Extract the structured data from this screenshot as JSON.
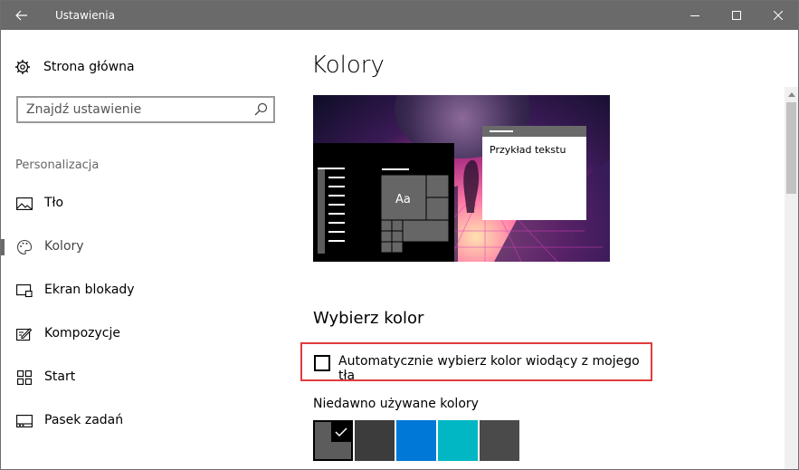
{
  "window": {
    "title": "Ustawienia"
  },
  "sidebar": {
    "home_label": "Strona główna",
    "search_placeholder": "Znajdź ustawienie",
    "section_label": "Personalizacja",
    "items": [
      {
        "label": "Tło",
        "icon": "picture-icon"
      },
      {
        "label": "Kolory",
        "icon": "palette-icon",
        "active": true
      },
      {
        "label": "Ekran blokady",
        "icon": "lock-screen-icon"
      },
      {
        "label": "Kompozycje",
        "icon": "themes-icon"
      },
      {
        "label": "Start",
        "icon": "start-icon"
      },
      {
        "label": "Pasek zadań",
        "icon": "taskbar-icon"
      }
    ]
  },
  "main": {
    "title": "Kolory",
    "preview": {
      "tile_label": "Aa",
      "sample_text": "Przykład tekstu"
    },
    "choose_color_title": "Wybierz kolor",
    "auto_color_label": "Automatycznie wybierz kolor wiodący z mojego tła",
    "auto_color_checked": false,
    "recent_colors_label": "Niedawno używane kolory",
    "recent_colors": [
      "#5c5c5c",
      "#3c3c3c",
      "#0078d7",
      "#00b7c3",
      "#4a4a4a"
    ],
    "selected_color_index": 0
  },
  "colors": {
    "titlebar": "#6a6a6a",
    "highlight_border": "#e03c3c",
    "accent": "#6a6a6a"
  }
}
